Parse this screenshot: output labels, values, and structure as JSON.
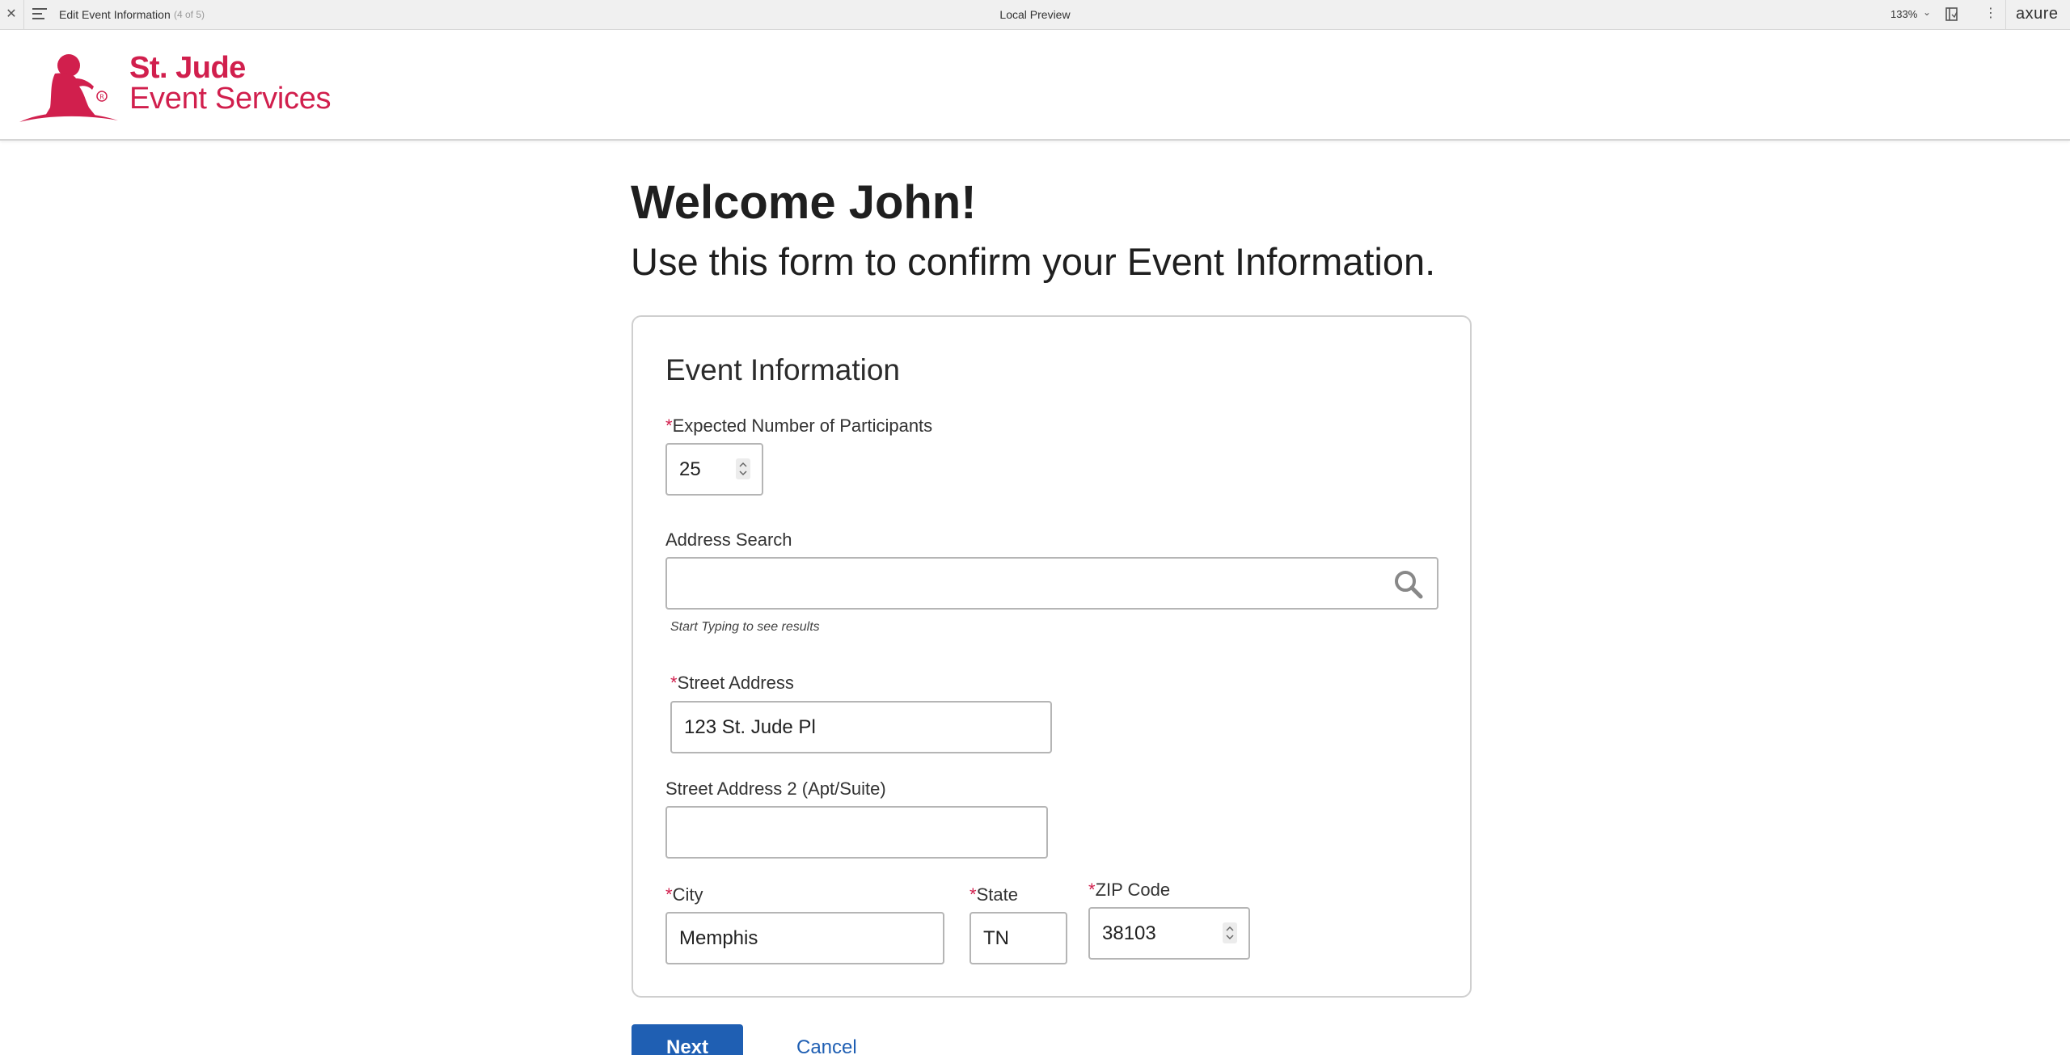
{
  "toolbar": {
    "page_name": "Edit Event Information",
    "page_count": "(4 of 5)",
    "center_title": "Local Preview",
    "zoom": "133%",
    "brand": "axure"
  },
  "header": {
    "logo_line1": "St. Jude",
    "logo_line2": "Event Services",
    "brand_color": "#d11f4d"
  },
  "main": {
    "title": "Welcome John!",
    "subtitle": "Use this form to confirm your Event Information."
  },
  "form": {
    "section_title": "Event Information",
    "required_marker": "*",
    "participants": {
      "label": "Expected Number of Participants",
      "value": "25"
    },
    "address_search": {
      "label": "Address Search",
      "value": "",
      "hint": "Start Typing to see results"
    },
    "street": {
      "label": "Street Address",
      "value": "123 St. Jude Pl"
    },
    "street2": {
      "label": "Street Address 2 (Apt/Suite)",
      "value": ""
    },
    "city": {
      "label": "City",
      "value": "Memphis"
    },
    "state": {
      "label": "State",
      "value": "TN"
    },
    "zip": {
      "label": "ZIP Code",
      "value": "38103"
    }
  },
  "actions": {
    "next": "Next",
    "cancel": "Cancel",
    "primary_color": "#1f5fb3"
  }
}
